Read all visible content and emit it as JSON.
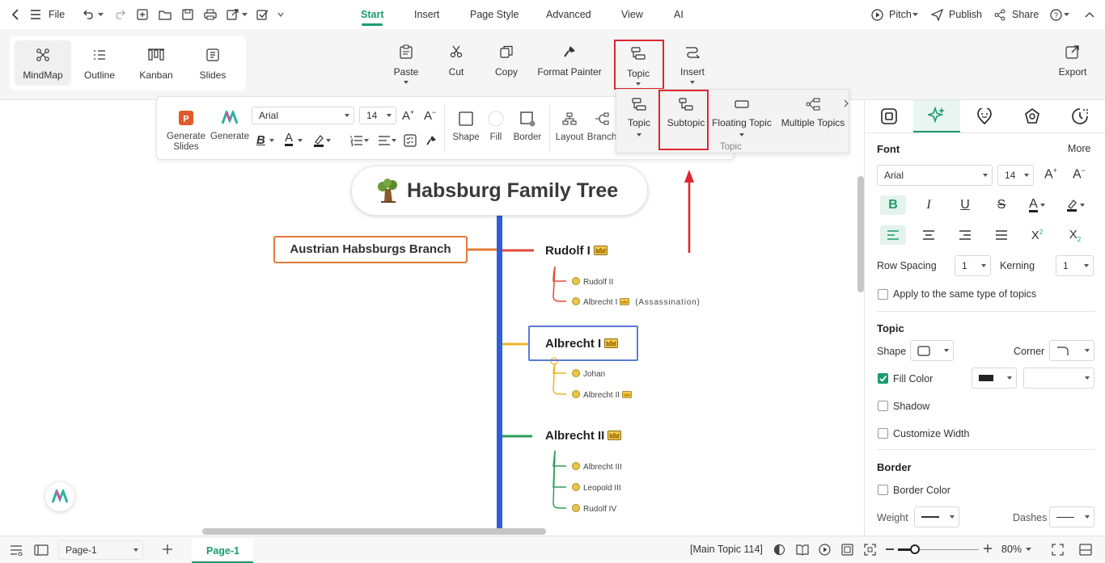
{
  "titlebar": {
    "file_label": "File",
    "menu_tabs": [
      "Start",
      "Insert",
      "Page Style",
      "Advanced",
      "View",
      "AI"
    ],
    "active_tab": "Start",
    "pitch_label": "Pitch",
    "publish_label": "Publish",
    "share_label": "Share"
  },
  "ribbon": {
    "view_modes": [
      "MindMap",
      "Outline",
      "Kanban",
      "Slides"
    ],
    "active_view": "MindMap",
    "buttons": {
      "paste": "Paste",
      "cut": "Cut",
      "copy": "Copy",
      "format_painter": "Format Painter",
      "topic": "Topic",
      "insert": "Insert",
      "export": "Export"
    }
  },
  "floatbar": {
    "generate_slides_line1": "Generate",
    "generate_slides_line2": "Slides",
    "generate": "Generate",
    "font": "Arial",
    "size": "14",
    "shape": "Shape",
    "fill": "Fill",
    "border": "Border",
    "layout": "Layout",
    "branch": "Branch"
  },
  "topic_panel": {
    "items": [
      "Topic",
      "Subtopic",
      "Floating Topic",
      "Multiple Topics"
    ],
    "group_label": "Topic"
  },
  "mindmap": {
    "title": "Habsburg Family Tree",
    "branch_label": "Austrian Habsburgs Branch",
    "topics": [
      {
        "label": "Rudolf I",
        "children": [
          "Rudolf II",
          "Albrecht I"
        ],
        "note": "(Assassination)"
      },
      {
        "label": "Albrecht I",
        "children": [
          "Johan",
          "Albrecht II"
        ]
      },
      {
        "label": "Albrecht II",
        "children": [
          "Albrecht III",
          "Leopold III",
          "Rudolf IV"
        ]
      }
    ],
    "colors": {
      "spine": "#2c5fd8",
      "branch": "#e07b39",
      "rudolf": "#e24a3b",
      "albrecht1": "#f0b429",
      "albrecht2": "#2f9e58",
      "selected": "#5b7bd5"
    }
  },
  "right_panel": {
    "font_section": "Font",
    "more": "More",
    "font": "Arial",
    "size": "14",
    "row_spacing_label": "Row Spacing",
    "row_spacing": "1",
    "kerning_label": "Kerning",
    "kerning": "1",
    "apply_same": "Apply to the same type of topics",
    "topic_section": "Topic",
    "shape_label": "Shape",
    "corner_label": "Corner",
    "fill_color": "Fill Color",
    "shadow": "Shadow",
    "customize_width": "Customize Width",
    "border_section": "Border",
    "border_color": "Border Color",
    "weight": "Weight",
    "dashes": "Dashes"
  },
  "statusbar": {
    "page_select": "Page-1",
    "page_tab": "Page-1",
    "topic_count": "[Main Topic 114]",
    "zoom": "80%"
  }
}
